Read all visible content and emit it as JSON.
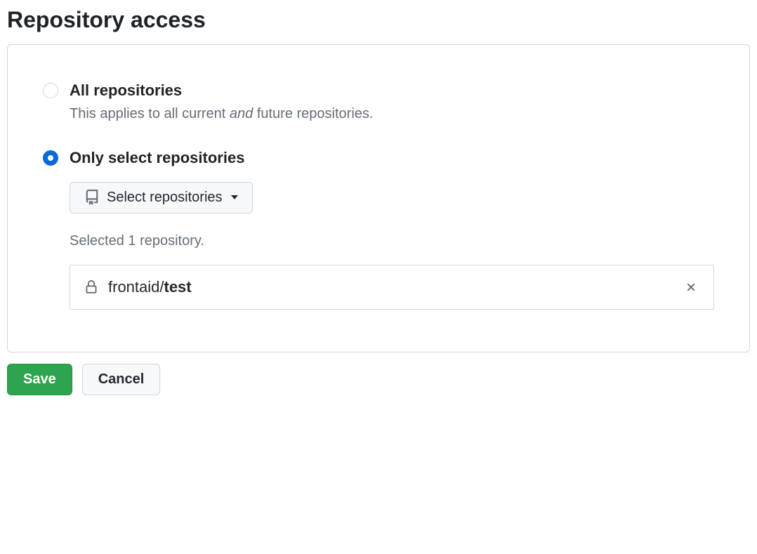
{
  "title": "Repository access",
  "options": {
    "all": {
      "label": "All repositories",
      "description_prefix": "This applies to all current ",
      "description_em": "and",
      "description_suffix": " future repositories.",
      "selected": false
    },
    "select": {
      "label": "Only select repositories",
      "selected": true,
      "button_label": "Select repositories",
      "selected_count_text": "Selected 1 repository."
    }
  },
  "repos": [
    {
      "owner": "frontaid/",
      "name": "test",
      "private": true
    }
  ],
  "actions": {
    "save": "Save",
    "cancel": "Cancel"
  }
}
